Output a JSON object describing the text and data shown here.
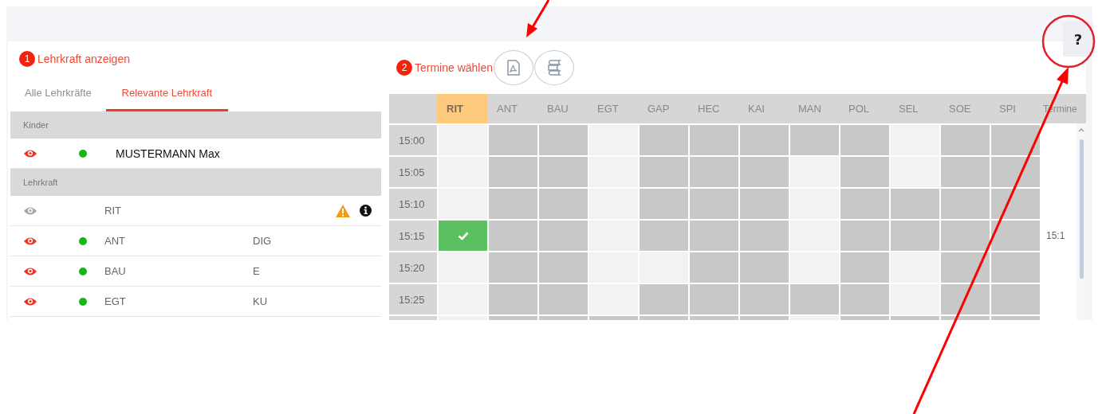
{
  "help_button": {
    "label": "?"
  },
  "teacher_panel": {
    "step": "1",
    "title": "Lehrkraft anzeigen",
    "tabs": [
      {
        "label": "Alle Lehrkräfte",
        "selected": false
      },
      {
        "label": "Relevante Lehrkraft",
        "selected": true
      }
    ],
    "groups": [
      {
        "title": "Kinder",
        "kind": "child",
        "rows": [
          {
            "visible": true,
            "online": true,
            "name": "MUSTERMANN Max",
            "warning": false,
            "info": false
          }
        ]
      },
      {
        "title": "Lehrkraft",
        "kind": "teacher",
        "rows": [
          {
            "visible": false,
            "online": false,
            "name": "RIT",
            "warning": true,
            "info": true
          },
          {
            "visible": true,
            "online": true,
            "name": "ANT",
            "subject": "DIG",
            "warning": false,
            "info": false
          },
          {
            "visible": true,
            "online": true,
            "name": "BAU",
            "subject": "E",
            "warning": false,
            "info": false
          },
          {
            "visible": true,
            "online": true,
            "name": "EGT",
            "subject": "KU",
            "warning": false,
            "info": false
          }
        ]
      }
    ]
  },
  "schedule_panel": {
    "step": "2",
    "title": "Termine wählen",
    "columns": [
      {
        "label": "RIT",
        "selected": true
      },
      {
        "label": "ANT",
        "selected": false
      },
      {
        "label": "BAU",
        "selected": false
      },
      {
        "label": "EGT",
        "selected": false
      },
      {
        "label": "GAP",
        "selected": false
      },
      {
        "label": "HEC",
        "selected": false
      },
      {
        "label": "KAI",
        "selected": false
      },
      {
        "label": "MAN",
        "selected": false
      },
      {
        "label": "POL",
        "selected": false
      },
      {
        "label": "SEL",
        "selected": false
      },
      {
        "label": "SOE",
        "selected": false
      },
      {
        "label": "SPI",
        "selected": false
      }
    ],
    "appointments_header": "Termine",
    "rows": [
      {
        "time": "15:00",
        "slots": [
          {
            "kind": "free"
          },
          {
            "kind": "busy"
          },
          {
            "kind": "busy"
          },
          {
            "kind": "free"
          },
          {
            "kind": "busy"
          },
          {
            "kind": "busy"
          },
          {
            "kind": "busy"
          },
          {
            "kind": "busy"
          },
          {
            "kind": "busy"
          },
          {
            "kind": "free"
          },
          {
            "kind": "busy"
          },
          {
            "kind": "busy"
          }
        ]
      },
      {
        "time": "15:05",
        "slots": [
          {
            "kind": "free"
          },
          {
            "kind": "busy"
          },
          {
            "kind": "busy"
          },
          {
            "kind": "free"
          },
          {
            "kind": "busy"
          },
          {
            "kind": "busy"
          },
          {
            "kind": "busy"
          },
          {
            "kind": "free"
          },
          {
            "kind": "busy"
          },
          {
            "kind": "free"
          },
          {
            "kind": "busy"
          },
          {
            "kind": "busy"
          }
        ]
      },
      {
        "time": "15:10",
        "slots": [
          {
            "kind": "free"
          },
          {
            "kind": "busy"
          },
          {
            "kind": "busy"
          },
          {
            "kind": "free"
          },
          {
            "kind": "busy"
          },
          {
            "kind": "busy"
          },
          {
            "kind": "busy"
          },
          {
            "kind": "free"
          },
          {
            "kind": "busy"
          },
          {
            "kind": "busy"
          },
          {
            "kind": "busy"
          },
          {
            "kind": "busy"
          }
        ]
      },
      {
        "time": "15:15",
        "slots": [
          {
            "kind": "booked"
          },
          {
            "kind": "busy"
          },
          {
            "kind": "busy"
          },
          {
            "kind": "free"
          },
          {
            "kind": "busy"
          },
          {
            "kind": "busy"
          },
          {
            "kind": "busy"
          },
          {
            "kind": "free"
          },
          {
            "kind": "busy"
          },
          {
            "kind": "busy"
          },
          {
            "kind": "busy"
          },
          {
            "kind": "busy"
          }
        ],
        "appointment": "15:1"
      },
      {
        "time": "15:20",
        "slots": [
          {
            "kind": "free"
          },
          {
            "kind": "busy"
          },
          {
            "kind": "busy"
          },
          {
            "kind": "free"
          },
          {
            "kind": "free"
          },
          {
            "kind": "busy"
          },
          {
            "kind": "busy"
          },
          {
            "kind": "free"
          },
          {
            "kind": "busy"
          },
          {
            "kind": "free"
          },
          {
            "kind": "busy"
          },
          {
            "kind": "busy"
          }
        ]
      },
      {
        "time": "15:25",
        "slots": [
          {
            "kind": "free"
          },
          {
            "kind": "busy"
          },
          {
            "kind": "busy"
          },
          {
            "kind": "free"
          },
          {
            "kind": "busy"
          },
          {
            "kind": "busy"
          },
          {
            "kind": "busy"
          },
          {
            "kind": "busy"
          },
          {
            "kind": "busy"
          },
          {
            "kind": "free"
          },
          {
            "kind": "busy"
          },
          {
            "kind": "busy"
          }
        ]
      },
      {
        "slots": [
          {
            "kind": "free"
          },
          {
            "kind": "busy"
          },
          {
            "kind": "busy"
          },
          {
            "kind": "busy"
          },
          {
            "kind": "busy"
          },
          {
            "kind": "busy"
          },
          {
            "kind": "busy"
          },
          {
            "kind": "free"
          },
          {
            "kind": "busy"
          },
          {
            "kind": "busy"
          },
          {
            "kind": "busy"
          },
          {
            "kind": "busy"
          }
        ]
      }
    ]
  }
}
